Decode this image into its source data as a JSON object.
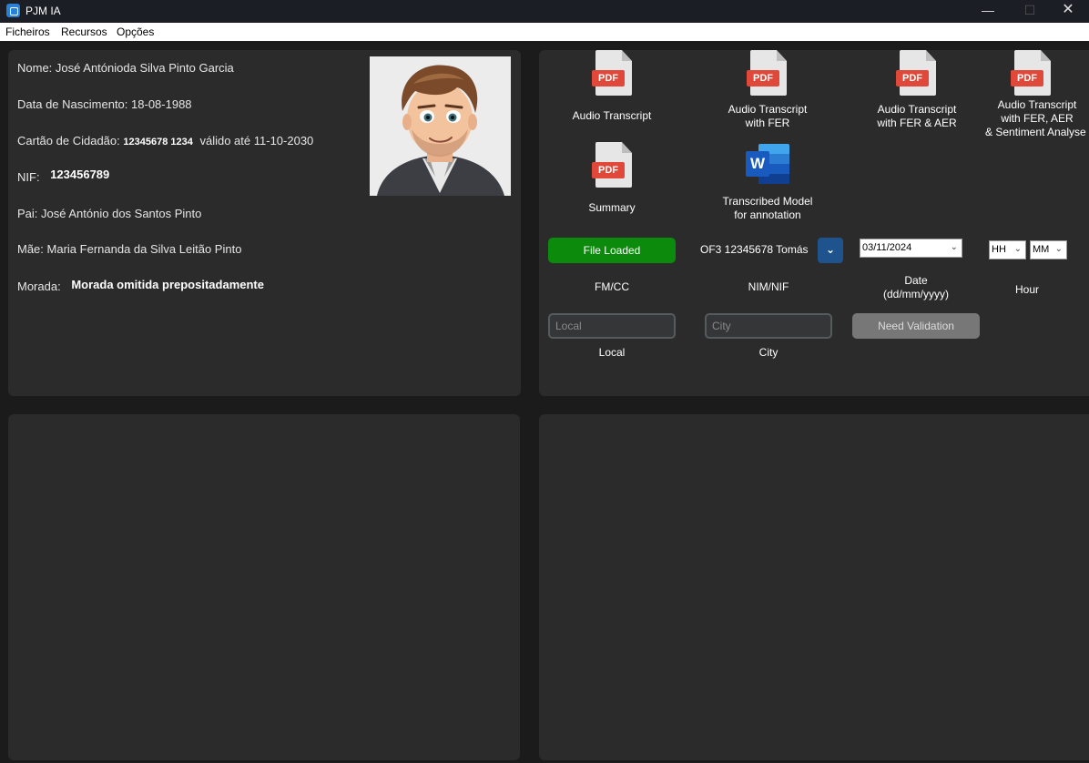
{
  "window": {
    "title": "PJM IA"
  },
  "menu": {
    "items": [
      "Ficheiros",
      "Recursos",
      "Opções"
    ]
  },
  "person": {
    "name_label": "Nome:",
    "name_value": "José Antónioda Silva Pinto Garcia",
    "birth_label": "Data de Nascimento:",
    "birth_value": "18-08-1988",
    "cc_label": "Cartão de Cidadão:",
    "cc_value": "12345678 1234",
    "cc_valid_label": "válido até",
    "cc_valid_value": "11-10-2030",
    "nif_label": "NIF:",
    "nif_value": "123456789",
    "father_label": "Pai:",
    "father_value": "José António dos Santos Pinto",
    "mother_label": "Mãe:",
    "mother_value": "Maria Fernanda da Silva Leitão Pinto",
    "address_label": "Morada:",
    "address_value": "Morada omitida prepositadamente"
  },
  "files": {
    "pdf_text": "PDF",
    "word_text": "W",
    "items": [
      {
        "line1": "Audio Transcript",
        "line2": "",
        "line3": ""
      },
      {
        "line1": "Audio Transcript",
        "line2": "with FER",
        "line3": ""
      },
      {
        "line1": "Audio Transcript",
        "line2": "with FER & AER",
        "line3": ""
      },
      {
        "line1": "Audio Transcript",
        "line2": "with FER, AER",
        "line3": "& Sentiment Analyse"
      },
      {
        "line1": "Summary",
        "line2": "",
        "line3": ""
      },
      {
        "line1": "Transcribed Model",
        "line2": "for annotation",
        "line3": ""
      }
    ]
  },
  "controls": {
    "file_button": "File Loaded",
    "fmcc_label": "FM/CC",
    "nim_value": "OF3 12345678 Tomás",
    "nim_label": "NIM/NIF",
    "date_value": "03/11/2024",
    "date_label_1": "Date",
    "date_label_2": "(dd/mm/yyyy)",
    "hour_value": "HH",
    "minute_value": "MM",
    "hour_label": "Hour",
    "local_placeholder": "Local",
    "local_label": "Local",
    "city_placeholder": "City",
    "city_label": "City",
    "validation_button": "Need Validation"
  },
  "colors": {
    "file_loaded": "#0c8a0c",
    "combo_button": "#1f538d",
    "pdf_red": "#e0483a",
    "word_blue": "#185abd"
  }
}
